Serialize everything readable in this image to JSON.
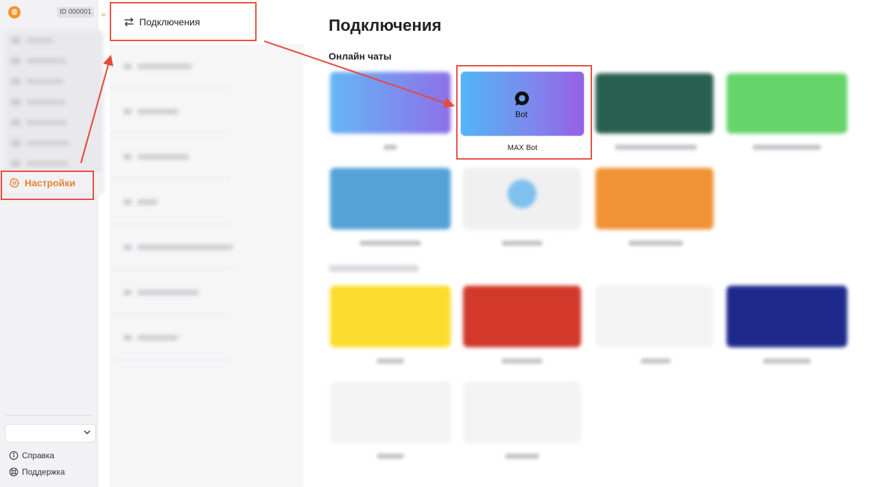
{
  "sidebar": {
    "account_id": "ID 000001",
    "collapse_icon": "«",
    "settings_label": "Настройки",
    "help_label": "Справка",
    "support_label": "Поддержка",
    "select_chevron": "⌄"
  },
  "submenu": {
    "connections_label": "Подключения"
  },
  "main": {
    "title": "Подключения",
    "online_chats_title": "Онлайн чаты",
    "max_bot": {
      "logo_text": "Bot",
      "label": "MAX Bot"
    }
  },
  "colors": {
    "accent": "#e7822f",
    "highlight": "#e64a3c"
  }
}
